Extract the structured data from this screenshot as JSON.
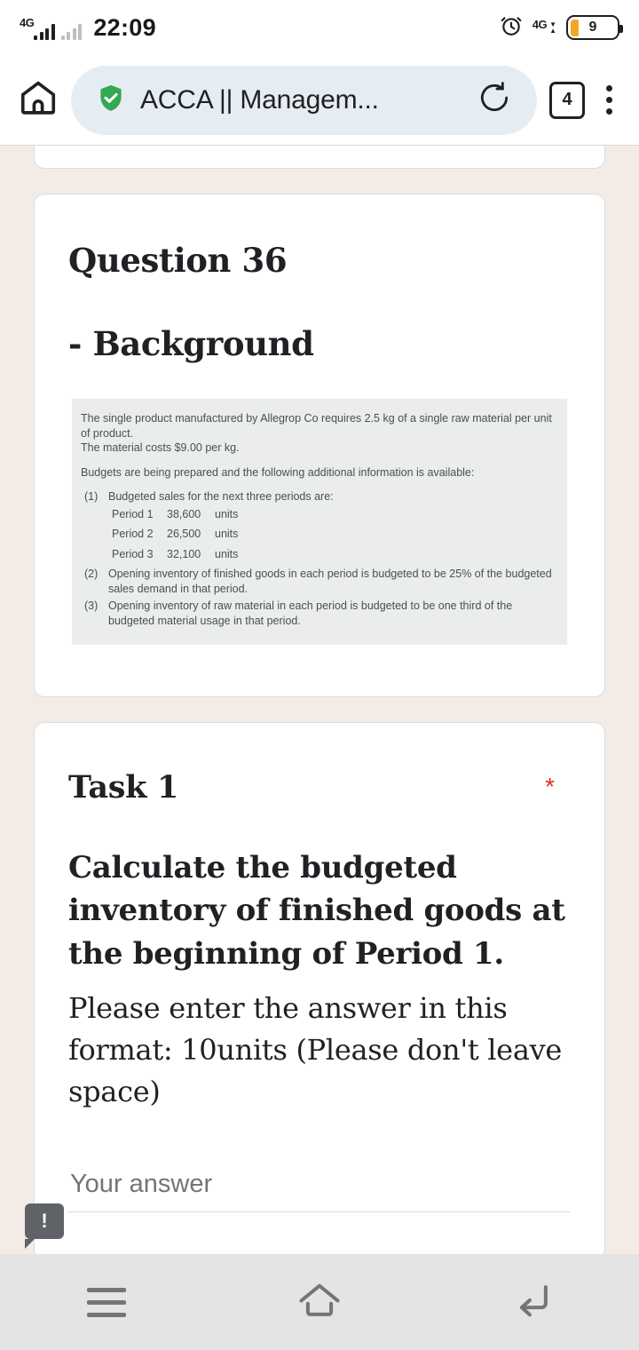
{
  "status_bar": {
    "network_label": "4G",
    "time": "22:09",
    "alarm_icon": "alarm-clock-icon",
    "data_label": "4G",
    "battery_percent": "9"
  },
  "browser": {
    "home_icon": "home-icon",
    "security_icon": "shield-check-icon",
    "page_title": "ACCA || Managem...",
    "reload_icon": "reload-icon",
    "tab_count": "4",
    "menu_icon": "three-dot-menu-icon"
  },
  "form": {
    "question_heading": "Question 36",
    "background_heading": "- Background",
    "background_image": {
      "intro_line1": "The single product manufactured by Allegrop Co requires 2.5 kg of a single raw material per unit of product.",
      "intro_line2": "The material costs $9.00 per kg.",
      "intro_line3": "Budgets are being prepared and the following additional information is available:",
      "items": [
        {
          "num": "(1)",
          "text": "Budgeted sales for the next three periods are:"
        },
        {
          "num": "(2)",
          "text": "Opening inventory of finished goods in each period is budgeted to be 25% of the budgeted sales demand in that period."
        },
        {
          "num": "(3)",
          "text": "Opening inventory of raw material in each period is budgeted to be one third of the budgeted material usage in that period."
        }
      ],
      "periods": [
        {
          "label": "Period 1",
          "value": "38,600",
          "unit": "units"
        },
        {
          "label": "Period 2",
          "value": "26,500",
          "unit": "units"
        },
        {
          "label": "Period 3",
          "value": "32,100",
          "unit": "units"
        }
      ]
    },
    "task": {
      "title": "Task 1",
      "required_marker": "*",
      "prompt": "Calculate the budgeted inventory of finished goods at the beginning of Period 1.",
      "note": "Please enter the answer in this format: 10units (Please don't leave space)",
      "answer_placeholder": "Your answer",
      "answer_value": ""
    },
    "error_badge": "!"
  },
  "nav_bar": {
    "recents_icon": "hamburger-recents-icon",
    "home_icon": "home-outline-icon",
    "back_icon": "back-arrow-icon"
  },
  "colors": {
    "page_background": "#f3ece6",
    "card_background": "#ffffff",
    "omnibox_background": "#e6edf2",
    "shield_green": "#34a853",
    "required_red": "#d93025",
    "battery_orange": "#f5a623",
    "image_block_background": "#ebedec"
  }
}
